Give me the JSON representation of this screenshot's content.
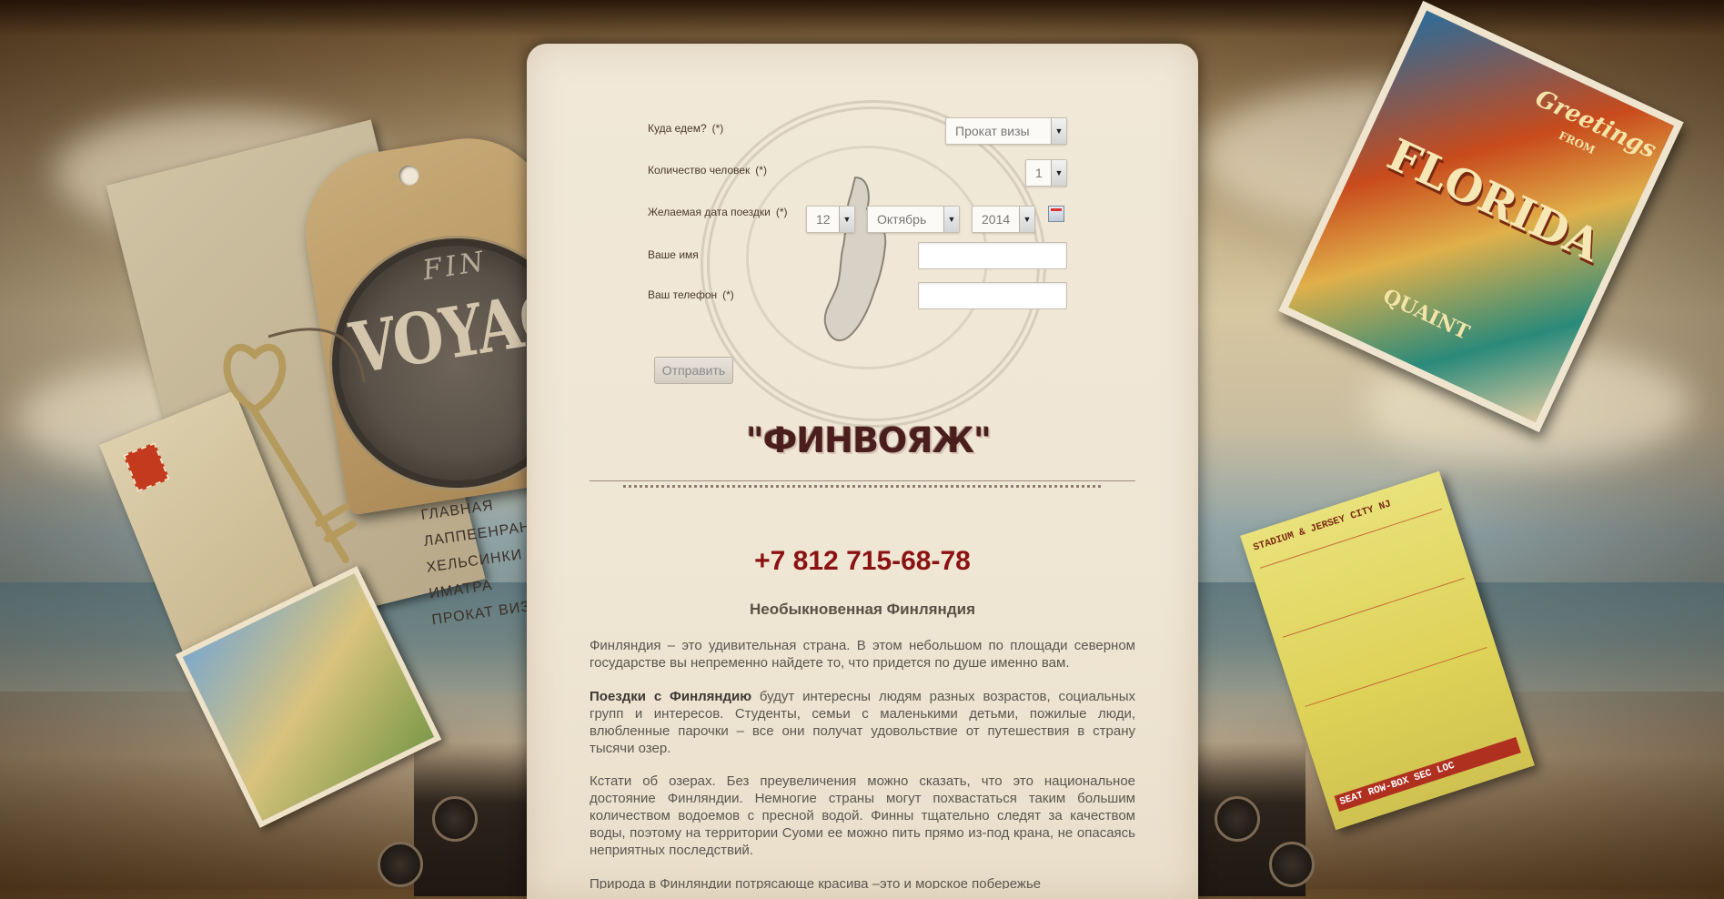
{
  "form": {
    "destination": {
      "label": "Куда едем?",
      "required": "(*)",
      "value": "Прокат визы"
    },
    "people": {
      "label": "Количество человек",
      "required": "(*)",
      "value": "1"
    },
    "date": {
      "label": "Желаемая дата поездки",
      "required": "(*)",
      "day": "12",
      "month": "Октябрь",
      "year": "2014"
    },
    "name": {
      "label": "Ваше имя",
      "value": ""
    },
    "phone": {
      "label": "Ваш телефон",
      "required": "(*)",
      "value": ""
    },
    "submit_label": "Отправить"
  },
  "brand": {
    "title": "\"ФИНВОЯЖ\"",
    "logo_top": "FIN",
    "logo_main": "VOYAGE"
  },
  "nav": {
    "items": [
      "ГЛАВНАЯ",
      "ЛАППЕЕНРАНТА",
      "ХЕЛЬСИНКИ",
      "ИМАТРА",
      "ПРОКАТ ВИЗЫ"
    ]
  },
  "content": {
    "phone": "+7 812 715-68-78",
    "heading": "Необыкновенная Финляндия",
    "p1": "Финляндия – это удивительная страна. В этом небольшом по площади северном государстве вы непременно найдете то, что придется по душе именно вам.",
    "p2_bold": "Поездки с Финляндию",
    "p2_rest": " будут интересны людям разных возрастов, социальных групп и интересов. Студенты, семьи с маленькими детьми, пожилые люди, влюбленные парочки – все они получат удовольствие от путешествия в страну тысячи озер.",
    "p3": "Кстати об озерах. Без преувеличения можно сказать, что  это национальное достояние Финляндии. Немногие страны могут похвастаться таким большим количеством водоемов с пресной водой. Финны тщательно следят за качеством воды, поэтому на территории Суоми ее можно пить прямо из-под крана, не опасаясь неприятных последствий.",
    "p4": "Природа в Финляндии потрясающе красива –это и морское побережье"
  },
  "decor": {
    "florida_greetings": "Greetings",
    "florida_from": "FROM",
    "florida_state": "FLORIDA",
    "florida_quaint": "QUAINT",
    "ticket_top": "STADIUM & JERSEY CITY NJ",
    "ticket_seat": "SEAT  ROW-BOX  SEC LOC"
  },
  "colors": {
    "accent_phone": "#8b1212",
    "brand_title": "#4b1e1e",
    "paper": "#f1e8d8"
  }
}
